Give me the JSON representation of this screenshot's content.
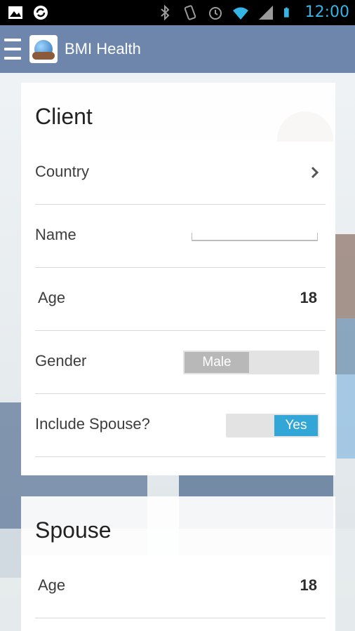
{
  "status_bar": {
    "time": "12:00",
    "icons_left": [
      "image-icon",
      "sync-icon"
    ],
    "icons_right": [
      "bluetooth-icon",
      "vibrate-icon",
      "alarm-icon",
      "wifi-icon",
      "signal-icon",
      "battery-icon"
    ]
  },
  "action_bar": {
    "title": "BMI Health",
    "background": "#6e86ab"
  },
  "client": {
    "header": "Client",
    "country_label": "Country",
    "name_label": "Name",
    "name_value": "",
    "age_label": "Age",
    "age_value": "18",
    "gender_label": "Gender",
    "gender_value": "Male",
    "spouse_label": "Include Spouse?",
    "spouse_value": "Yes"
  },
  "spouse": {
    "header": "Spouse",
    "age_label": "Age",
    "age_value": "18"
  },
  "colors": {
    "accent": "#33a6d8",
    "status_text": "#33b5e5"
  }
}
